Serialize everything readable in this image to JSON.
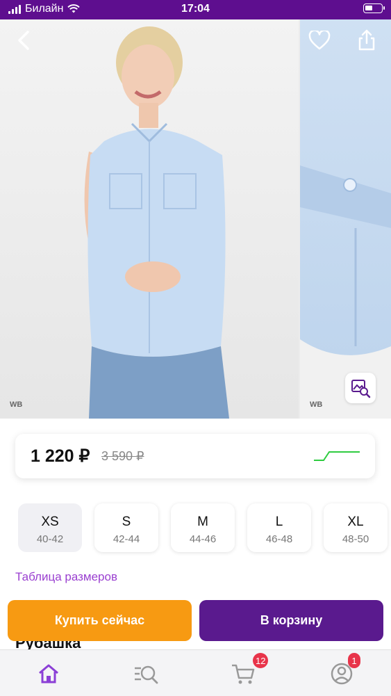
{
  "status_bar": {
    "carrier": "Билайн",
    "time": "17:04"
  },
  "gallery": {
    "watermark_main": "WB",
    "watermark_side": "WB"
  },
  "icons": {
    "back": "chevron-left-icon",
    "favorite": "heart-icon",
    "share": "share-icon",
    "visual_search": "image-search-icon"
  },
  "price": {
    "current": "1 220 ₽",
    "old": "3 590 ₽",
    "history_color": "#2ecc40"
  },
  "sizes": [
    {
      "size": "XS",
      "range": "40-42",
      "selected": true
    },
    {
      "size": "S",
      "range": "42-44",
      "selected": false
    },
    {
      "size": "M",
      "range": "44-46",
      "selected": false
    },
    {
      "size": "L",
      "range": "46-48",
      "selected": false
    },
    {
      "size": "XL",
      "range": "48-50",
      "selected": false
    }
  ],
  "size_table_label": "Таблица размеров",
  "product_title": "Рубашка",
  "actions": {
    "buy_now": "Купить сейчас",
    "add_to_cart": "В корзину"
  },
  "tab_bar": {
    "home_icon": "home-icon",
    "catalog_icon": "catalog-search-icon",
    "cart_icon": "cart-icon",
    "cart_badge": "12",
    "profile_icon": "profile-icon",
    "profile_badge": "1"
  },
  "colors": {
    "accent": "#5a1a8e",
    "buy_now": "#f79a12",
    "link": "#9a3fd0",
    "status_bar": "#5e0e8f",
    "badge": "#e8344a"
  }
}
